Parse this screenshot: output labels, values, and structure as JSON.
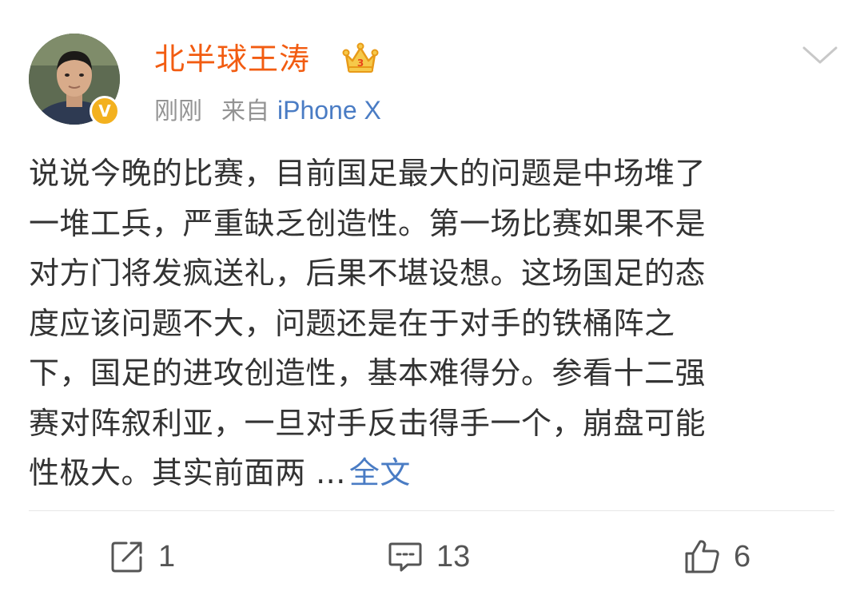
{
  "post": {
    "author": {
      "name": "北半球王涛",
      "verified_badge": "V",
      "avatar_icon": "user-avatar-photo",
      "member_icon": "crown-vip-icon"
    },
    "meta": {
      "time": "刚刚",
      "source_prefix": "来自",
      "device": "iPhone X"
    },
    "menu_icon": "chevron-down-icon",
    "text_lines": [
      "说说今晚的比赛，目前国足最大的问题是中场堆了",
      "一堆工兵，严重缺乏创造性。第一场比赛如果不是",
      "对方门将发疯送礼，后果不堪设想。这场国足的态",
      "度应该问题不大，问题还是在于对手的铁桶阵之",
      "下，国足的进攻创造性，基本难得分。参看十二强",
      "赛对阵叙利亚，一旦对手反击得手一个，崩盘可能",
      "性极大。其实前面两 ..."
    ],
    "full_text_link": "全文"
  },
  "actions": {
    "repost": {
      "icon": "repost-icon",
      "count": "1"
    },
    "comment": {
      "icon": "comment-icon",
      "count": "13"
    },
    "like": {
      "icon": "thumbs-up-icon",
      "count": "6"
    }
  },
  "colors": {
    "username": "#f25c11",
    "link": "#4a7cc4",
    "meta_gray": "#939393",
    "body_text": "#333333",
    "verified_gold": "#f3b11f"
  }
}
